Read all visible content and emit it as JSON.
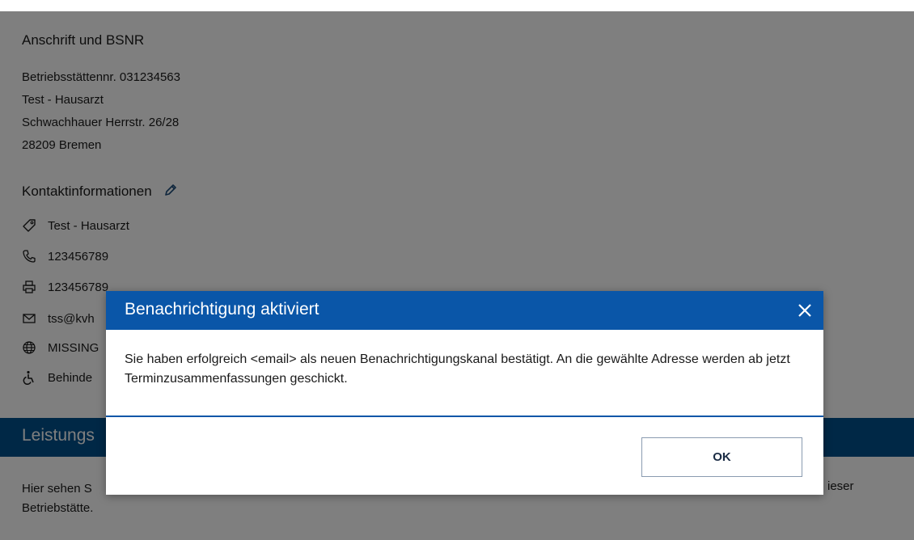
{
  "address_section": {
    "title": "Anschrift und BSNR",
    "lines": [
      "Betriebsstättennr. 031234563",
      "Test - Hausarzt",
      "Schwachhauer Herrstr. 26/28",
      "28209 Bremen"
    ]
  },
  "contact_section": {
    "title": "Kontaktinformationen",
    "items": [
      {
        "icon": "tag-icon",
        "text": "Test - Hausarzt"
      },
      {
        "icon": "phone-icon",
        "text": "123456789"
      },
      {
        "icon": "printer-icon",
        "text": "123456789"
      },
      {
        "icon": "mail-icon",
        "text": "tss@kvh"
      },
      {
        "icon": "globe-icon",
        "text": "MISSING"
      },
      {
        "icon": "wheelchair-icon",
        "text": "Behinde"
      }
    ]
  },
  "services_band": {
    "title": "Leistungs"
  },
  "description": {
    "text": "Hier sehen S",
    "text_end": "ieser",
    "line2": "Betriebstätte."
  },
  "modal": {
    "title": "Benachrichtigung aktiviert",
    "body": "Sie haben erfolgreich <email> als neuen Benachrichtigungskanal bestätigt. An die gewählte Adresse werden ab jetzt Terminzusammenfassungen geschickt.",
    "ok_label": "OK"
  },
  "colors": {
    "modal_header": "#0a56a8",
    "band": "#00508c",
    "overlay": "rgba(0,0,0,0.5)"
  }
}
